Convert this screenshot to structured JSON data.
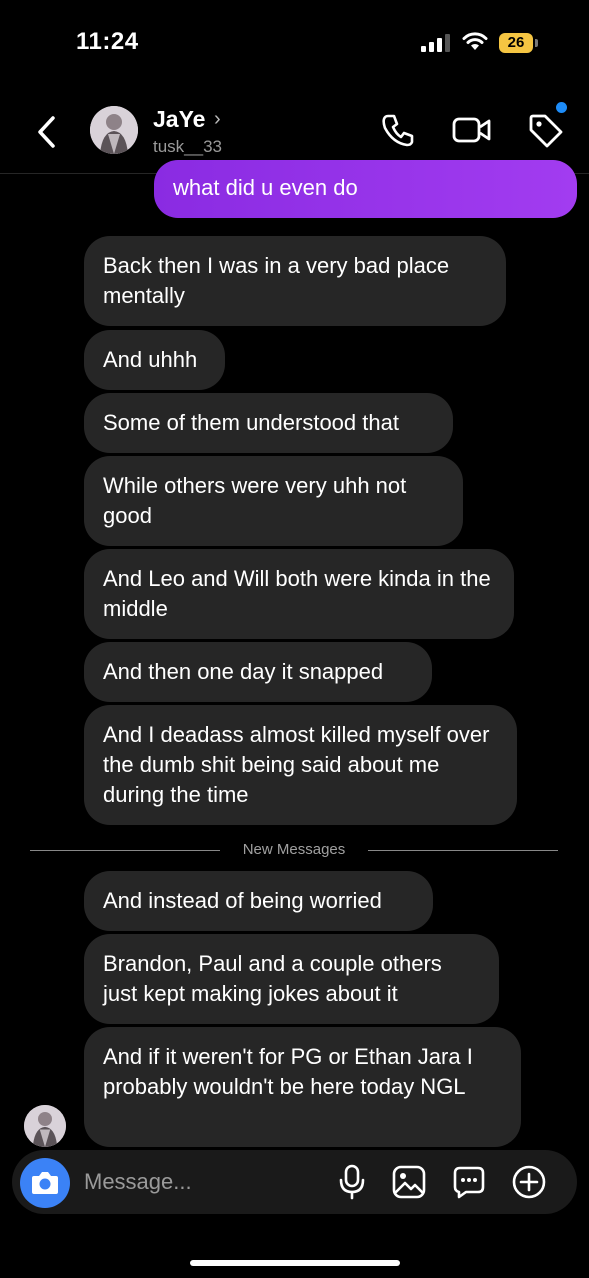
{
  "status_bar": {
    "time": "11:24",
    "battery": "26"
  },
  "header": {
    "name": "JaYe",
    "chevron": "›",
    "handle": "tusk__33"
  },
  "messages": {
    "sent": "what did u even do",
    "received": [
      "Back then I was in a very bad place mentally",
      "And uhhh",
      "Some of them understood that",
      "While others were very uhh not good",
      "And Leo and Will both were kinda in the middle",
      "And then one day it snapped",
      "And I deadass almost killed myself over the dumb shit being said about me during the time"
    ],
    "divider_label": "New Messages",
    "received_new": [
      "And instead of being worried",
      "Brandon, Paul and a couple others just kept making jokes about it",
      "And if it weren't for PG or Ethan Jara I probably wouldn't be here today NGL"
    ]
  },
  "composer": {
    "placeholder": "Message..."
  },
  "colors": {
    "sent_bubble_start": "#8a2be2",
    "sent_bubble_end": "#a23cf0",
    "received_bubble": "#262626",
    "camera_button": "#3b82f6",
    "notify_dot": "#1d8cf8"
  },
  "icons": [
    "back-icon",
    "call-icon",
    "video-icon",
    "tag-icon",
    "camera-icon",
    "mic-icon",
    "gallery-icon",
    "sticker-icon",
    "plus-icon"
  ]
}
